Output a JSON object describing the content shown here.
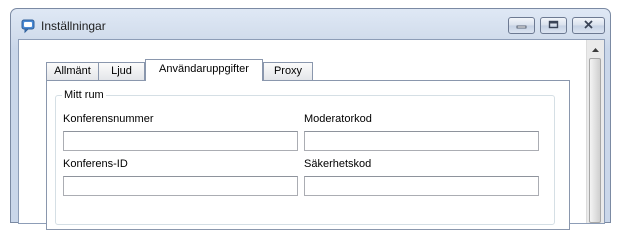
{
  "window": {
    "title": "Inställningar"
  },
  "tabs": [
    {
      "label": "Allmänt",
      "active": false
    },
    {
      "label": "Ljud",
      "active": false
    },
    {
      "label": "Användaruppgifter",
      "active": true
    },
    {
      "label": "Proxy",
      "active": false
    }
  ],
  "group": {
    "legend": "Mitt rum",
    "fields": {
      "conference_number": {
        "label": "Konferensnummer",
        "value": "",
        "placeholder": ""
      },
      "moderator_code": {
        "label": "Moderatorkod",
        "value": "",
        "placeholder": ""
      },
      "conference_id": {
        "label": "Konferens-ID",
        "value": "",
        "placeholder": ""
      },
      "security_code": {
        "label": "Säkerhetskod",
        "value": "",
        "placeholder": ""
      }
    }
  },
  "icons": {
    "app": "chat-bubble-icon",
    "minimize": "minimize-icon",
    "maximize": "maximize-icon",
    "close": "close-icon",
    "scroll_up": "chevron-up-icon"
  },
  "colors": {
    "title_bar": "#d3deed",
    "active_tab": "#ffffff",
    "border": "#8a97ad"
  }
}
